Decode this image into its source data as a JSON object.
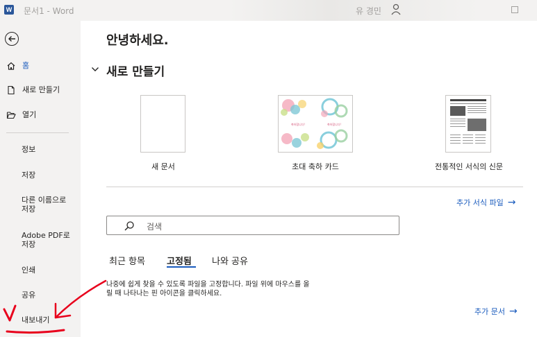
{
  "titlebar": {
    "doc_title": "문서1  -  Word",
    "logo_letter": "W",
    "user_name": "유 경민"
  },
  "sidebar": {
    "home": "홈",
    "new": "새로 만들기",
    "open": "열기",
    "info": "정보",
    "save": "저장",
    "save_as_line1": "다른 이름으로",
    "save_as_line2": "저장",
    "adobe_line1": "Adobe PDF로",
    "adobe_line2": "저장",
    "print": "인쇄",
    "share": "공유",
    "export": "내보내기"
  },
  "main": {
    "greeting": "안녕하세요.",
    "section_new": "새로 만들기",
    "templates": [
      {
        "label": "새 문서"
      },
      {
        "label": "초대 축하 카드"
      },
      {
        "label": "전통적인 서식의 신문"
      }
    ],
    "more_templates": "추가 서식 파일",
    "search_placeholder": "검색",
    "tabs": [
      "최근 항목",
      "고정됨",
      "나와 공유"
    ],
    "active_tab": "고정됨",
    "pinned_desc": "나중에 쉽게 찾을 수 있도록 파일을 고정합니다. 파일 위에 마우스를 올릴 때 나타나는 핀 아이콘을 클릭하세요.",
    "more_documents": "추가 문서",
    "arrow": "→"
  },
  "colors": {
    "accent": "#185abd",
    "word_brand": "#2b579a",
    "annotation": "#e8001c"
  }
}
